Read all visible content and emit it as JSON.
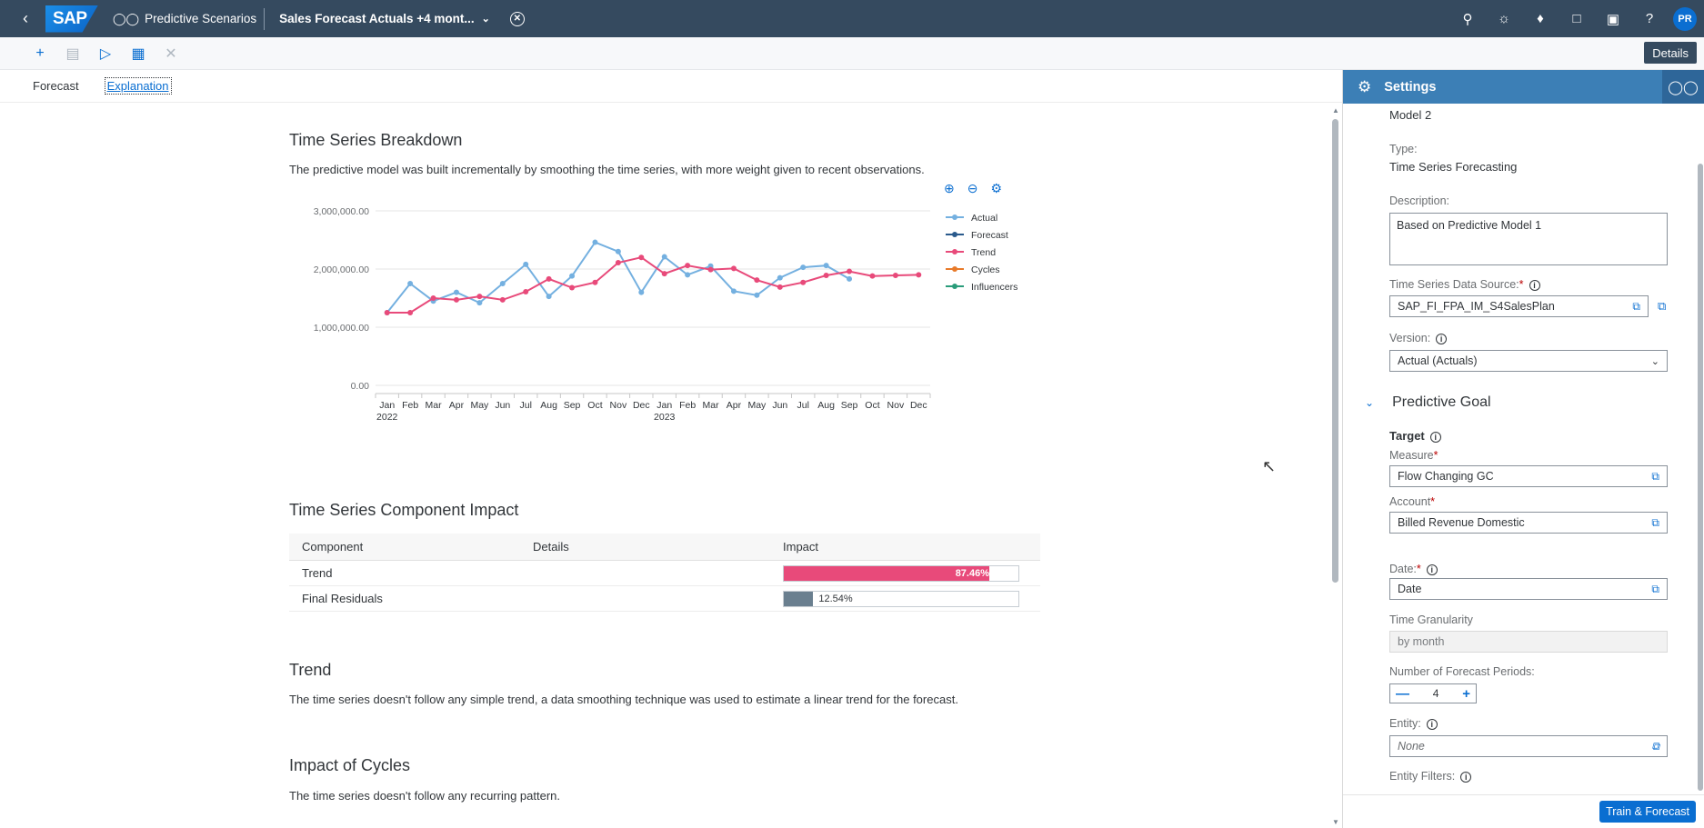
{
  "shell": {
    "app_title": "Predictive Scenarios",
    "story_title": "Sales Forecast Actuals +4 mont...",
    "avatar": "PR",
    "brand_color": "#354a5f"
  },
  "toolbar": {
    "details_label": "Details"
  },
  "tabs": {
    "forecast": "Forecast",
    "explanation": "Explanation"
  },
  "breakdown": {
    "title": "Time Series Breakdown",
    "description": "The predictive model was built incrementally by smoothing the time series, with more weight given to recent observations."
  },
  "chart_data": {
    "type": "line",
    "x": [
      "Jan 2022",
      "Feb 2022",
      "Mar 2022",
      "Apr 2022",
      "May 2022",
      "Jun 2022",
      "Jul 2022",
      "Aug 2022",
      "Sep 2022",
      "Oct 2022",
      "Nov 2022",
      "Dec 2022",
      "Jan 2023",
      "Feb 2023",
      "Mar 2023",
      "Apr 2023",
      "May 2023",
      "Jun 2023",
      "Jul 2023",
      "Aug 2023",
      "Sep 2023",
      "Oct 2023",
      "Nov 2023",
      "Dec 2023"
    ],
    "tick_labels": [
      "Jan",
      "Feb",
      "Mar",
      "Apr",
      "May",
      "Jun",
      "Jul",
      "Aug",
      "Sep",
      "Oct",
      "Nov",
      "Dec",
      "Jan",
      "Feb",
      "Mar",
      "Apr",
      "May",
      "Jun",
      "Jul",
      "Aug",
      "Sep",
      "Oct",
      "Nov",
      "Dec"
    ],
    "year_labels": [
      "2022",
      "2023"
    ],
    "y_ticks": [
      "3,000,000.00",
      "2,000,000.00",
      "1,000,000.00",
      "0.00"
    ],
    "ylim": [
      0,
      3000000
    ],
    "grid": true,
    "legend_position": "right",
    "series": [
      {
        "name": "Actual",
        "color": "#74b0e0",
        "values": [
          1250000,
          1750000,
          1450000,
          1600000,
          1420000,
          1750000,
          2080000,
          1530000,
          1880000,
          2460000,
          2300000,
          1600000,
          2210000,
          1900000,
          2050000,
          1620000,
          1550000,
          1850000,
          2030000,
          2060000,
          1830000,
          null,
          null,
          null
        ]
      },
      {
        "name": "Forecast",
        "color": "#2a5a8c",
        "values": []
      },
      {
        "name": "Trend",
        "color": "#e84a7a",
        "values": [
          1250000,
          1250000,
          1500000,
          1470000,
          1530000,
          1470000,
          1610000,
          1830000,
          1680000,
          1770000,
          2110000,
          2200000,
          1920000,
          2060000,
          1990000,
          2010000,
          1810000,
          1690000,
          1770000,
          1890000,
          1960000,
          1880000,
          1890000,
          1900000
        ]
      },
      {
        "name": "Cycles",
        "color": "#e87a2a",
        "values": []
      },
      {
        "name": "Influencers",
        "color": "#2a9c7a",
        "values": []
      }
    ]
  },
  "impact": {
    "title": "Time Series Component Impact",
    "headers": [
      "Component",
      "Details",
      "Impact"
    ],
    "rows": [
      {
        "component": "Trend",
        "details": "",
        "impact": 87.46,
        "label": "87.46%",
        "color": "#e84a7a"
      },
      {
        "component": "Final Residuals",
        "details": "",
        "impact": 12.54,
        "label": "12.54%",
        "color": "#6a7f8f"
      }
    ]
  },
  "trend": {
    "title": "Trend",
    "text": "The time series doesn't follow any simple trend, a data smoothing technique was used to estimate a linear trend for the forecast."
  },
  "cycles": {
    "title": "Impact of Cycles",
    "text": "The time series doesn't follow any recurring pattern."
  },
  "panel": {
    "title": "Settings",
    "model_name": "Model 2",
    "type_label": "Type:",
    "type_value": "Time Series Forecasting",
    "description_label": "Description:",
    "description_value": "Based on Predictive Model 1",
    "datasource_label": "Time Series Data Source:",
    "datasource_value": "SAP_FI_FPA_IM_S4SalesPlan",
    "version_label": "Version:",
    "version_value": "Actual (Actuals)",
    "goal_title": "Predictive Goal",
    "target_label": "Target",
    "measure_label": "Measure",
    "measure_value": "Flow Changing GC",
    "account_label": "Account",
    "account_value": "Billed Revenue Domestic",
    "date_label": "Date:",
    "date_value": "Date",
    "granularity_label": "Time Granularity",
    "granularity_value": "by month",
    "periods_label": "Number of Forecast Periods:",
    "periods_value": "4",
    "entity_label": "Entity:",
    "entity_value": "None",
    "entity_filters_label": "Entity Filters:",
    "train_label": "Train & Forecast"
  }
}
